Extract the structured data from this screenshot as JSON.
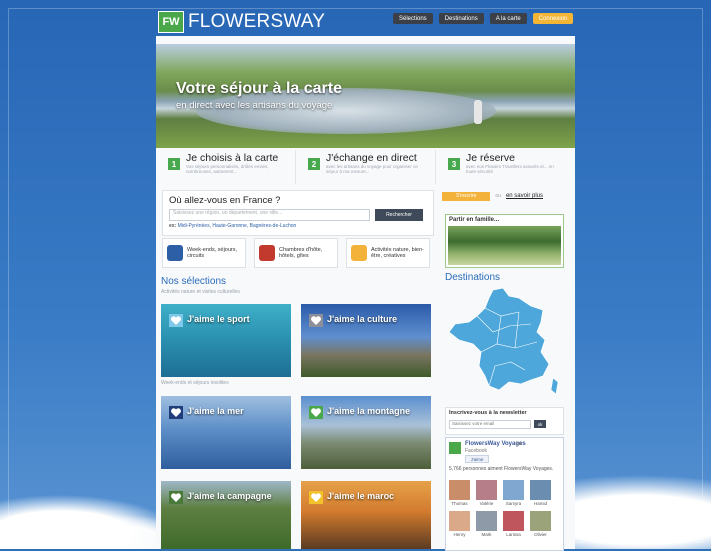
{
  "header": {
    "logo_badge": "FW",
    "logo_text": "FLOWERSWAY",
    "nav": [
      {
        "label": "Sélections"
      },
      {
        "label": "Destinations"
      },
      {
        "label": "A la carte"
      },
      {
        "label": "Connexion"
      }
    ]
  },
  "hero": {
    "title": "Votre séjour à la carte",
    "subtitle": "en direct avec les artisans du voyage"
  },
  "steps": [
    {
      "num": "1",
      "title": "Je choisis à la carte",
      "sub": "Vos séjours personnalisés, drôles envies, nombreuses, autrement..."
    },
    {
      "num": "2",
      "title": "J'échange en direct",
      "sub": "avec les artisans du voyage pour organiser ce séjour à ma mesure..."
    },
    {
      "num": "3",
      "title": "Je réserve",
      "sub": "avec nos Flowers Travellers assurés et... en toute sécurité"
    }
  ],
  "search": {
    "question": "Où allez-vous en France ?",
    "placeholder": "Saisissez une région, un département, une ville...",
    "button": "Rechercher",
    "example_prefix": "ex:",
    "examples": "Midi-Pyrénées, Haute-Garonne, Bagnères-de-Luchon"
  },
  "categories": [
    {
      "label": "Week-ends, séjours, circuits",
      "color": "#2d5fa6"
    },
    {
      "label": "Chambres d'hôte, hôtels, gîtes",
      "color": "#c23a2e"
    },
    {
      "label": "Activités nature, bien-être, créatives",
      "color": "#f3b23a"
    }
  ],
  "selections": {
    "title": "Nos sélections",
    "subtitle": "Activités nature et visites culturelles",
    "subtitle2": "Week-ends et séjours insolites",
    "tiles": [
      {
        "label": "J'aime le sport",
        "heart": "#7ec8ea"
      },
      {
        "label": "J'aime la culture",
        "heart": "#8b8f99"
      },
      {
        "label": "J'aime la mer",
        "heart": "#1f3d7a"
      },
      {
        "label": "J'aime la montagne",
        "heart": "#4aa84a"
      },
      {
        "label": "J'aime la campagne",
        "heart": "#4a7a3a"
      },
      {
        "label": "J'aime le maroc",
        "heart": "#f3c22a"
      }
    ]
  },
  "sidebar": {
    "tab_active": "S'inscrire",
    "tab_or": "ou",
    "tab_link": "en savoir plus",
    "famille": "Partir en famille...",
    "destinations": "Destinations",
    "newsletter_title": "Inscrivez-vous à la newsletter",
    "newsletter_placeholder": "Saisissez votre email",
    "newsletter_ok": "ok",
    "fb_name": "FlowersWay Voyages",
    "fb_on": "sur",
    "fb_network": "Facebook",
    "fb_like": "J'aime",
    "fb_count_text": "5,766 personnes aiment FlowersWay Voyages.",
    "fans": [
      "Thomas",
      "Valérie",
      "Samyra",
      "Hamid",
      "Henry",
      "Mark",
      "Larissa",
      "Olivier"
    ]
  }
}
